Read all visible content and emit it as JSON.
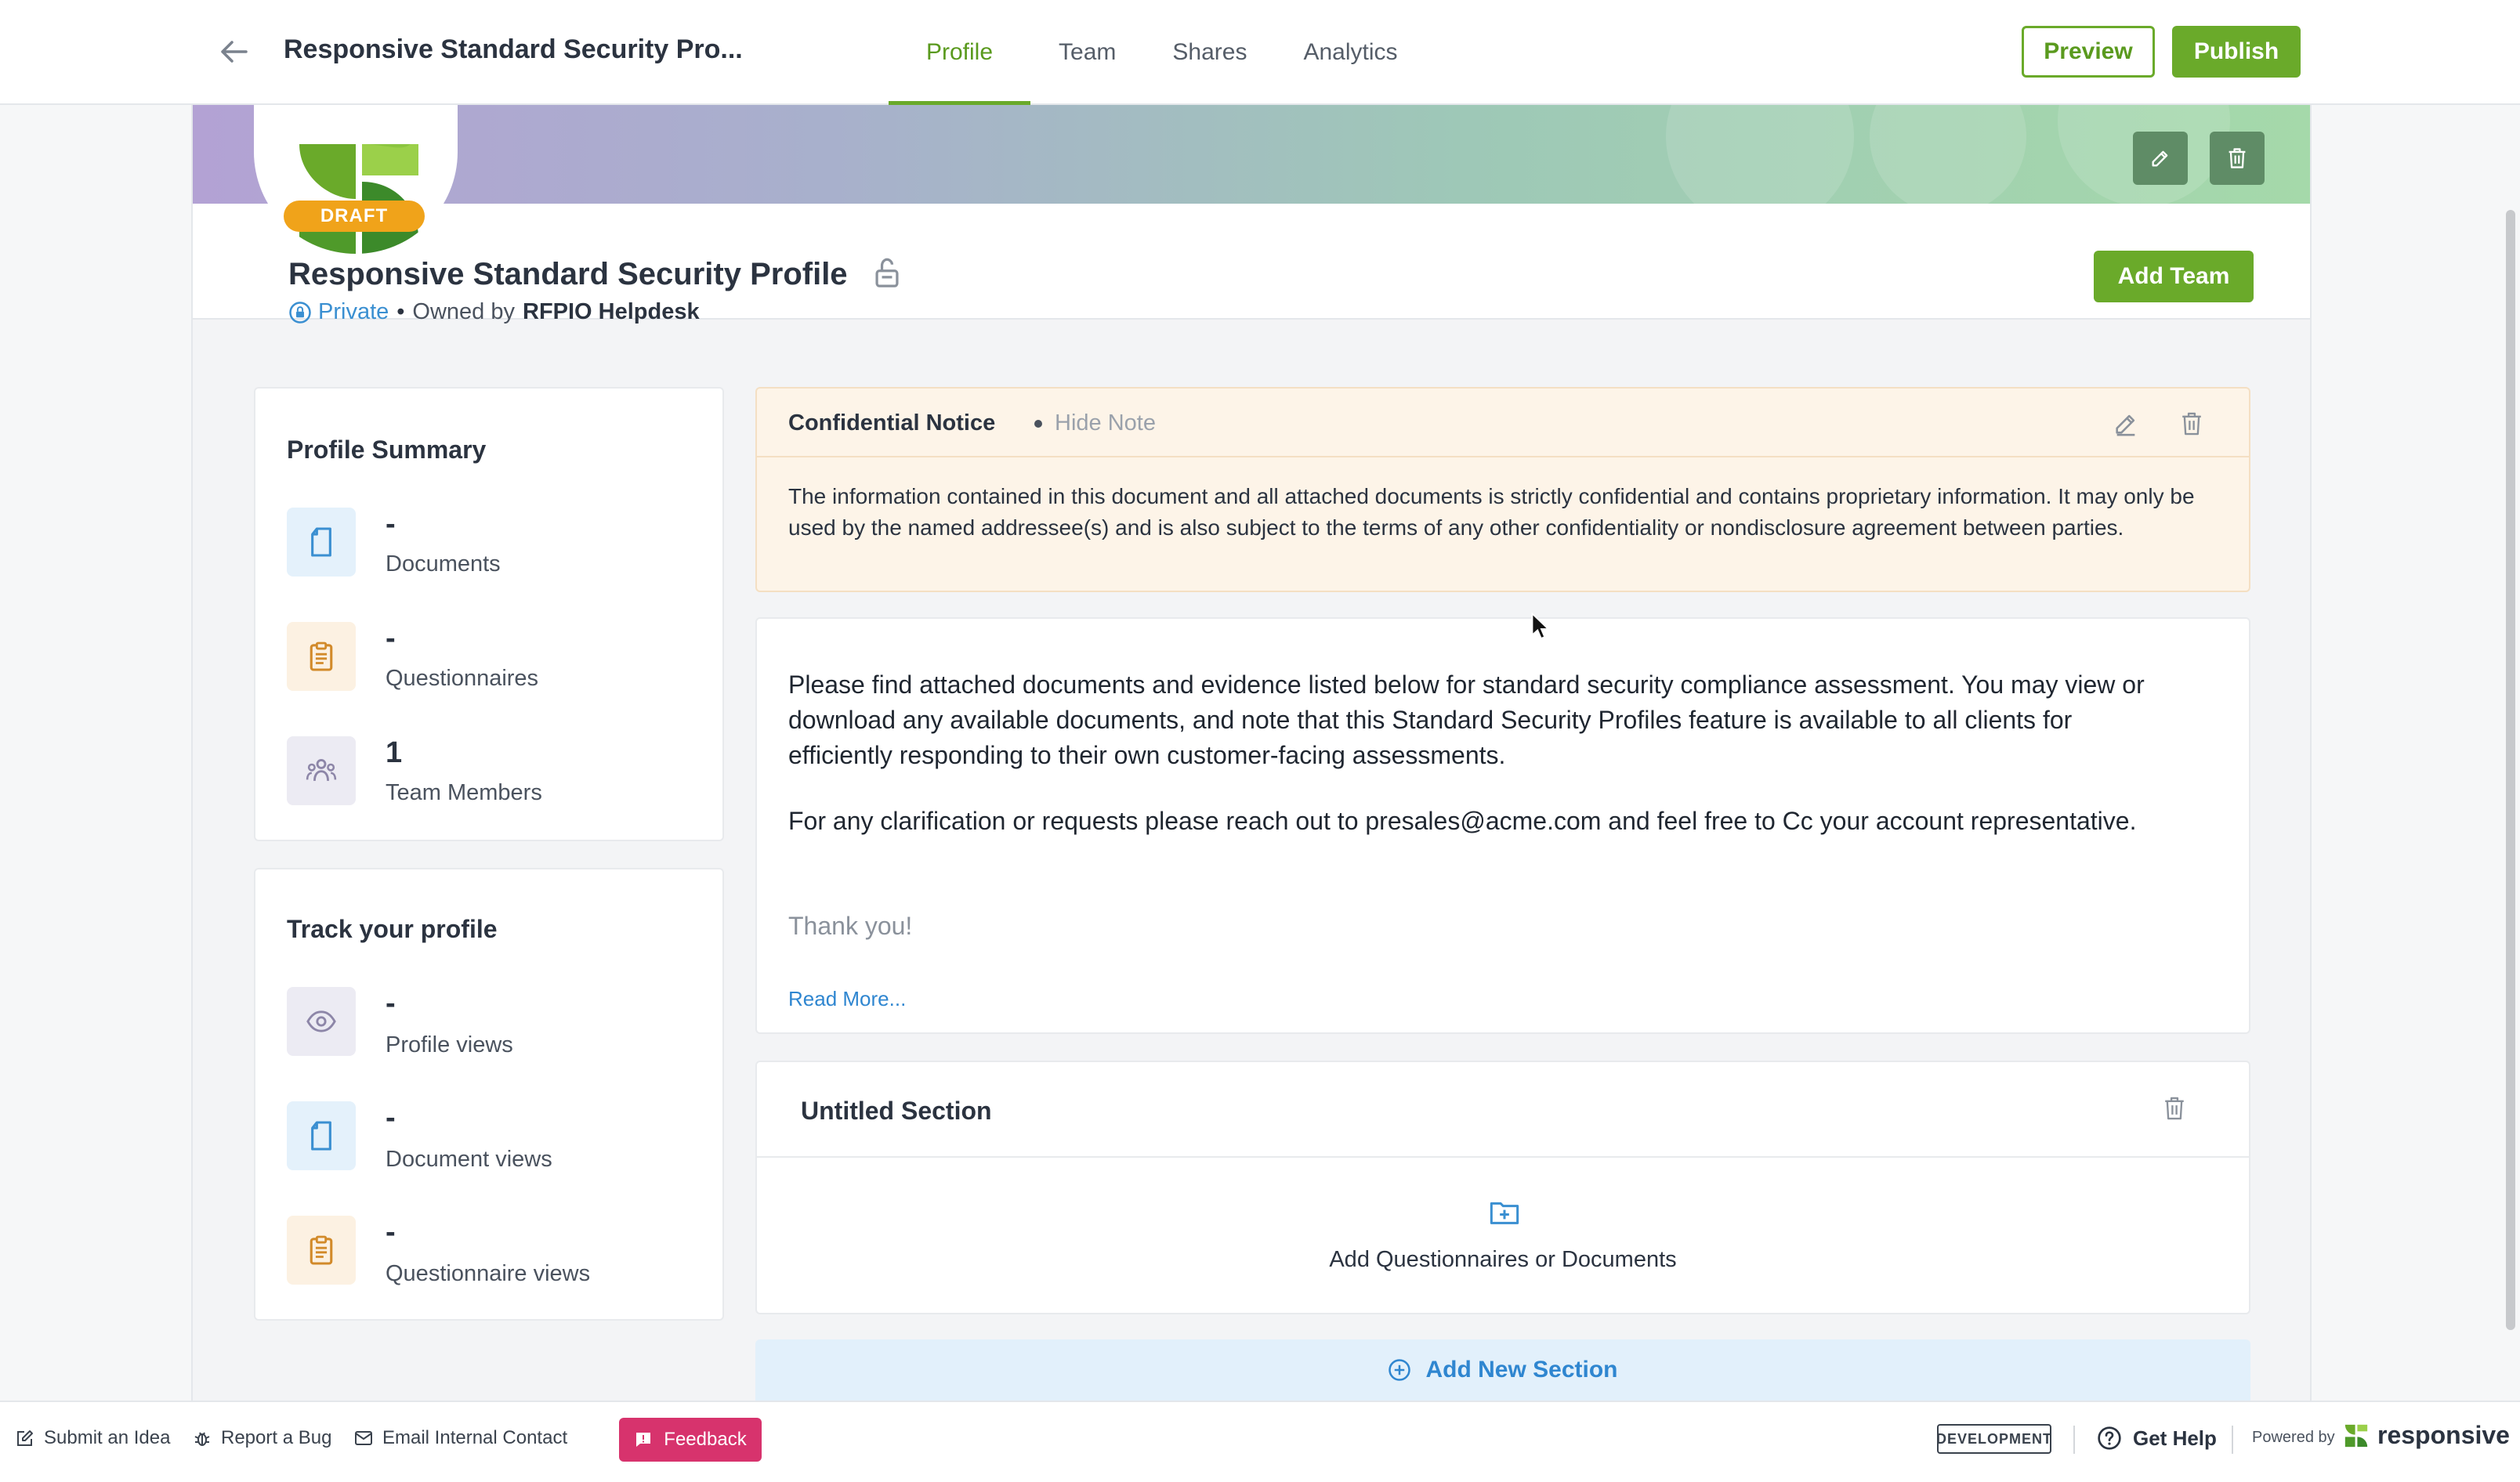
{
  "header": {
    "back_icon": "arrow-left-icon",
    "title": "Responsive Standard Security Pro...",
    "tabs": [
      {
        "label": "Profile",
        "active": true
      },
      {
        "label": "Team",
        "active": false
      },
      {
        "label": "Shares",
        "active": false
      },
      {
        "label": "Analytics",
        "active": false
      }
    ],
    "preview_label": "Preview",
    "publish_label": "Publish"
  },
  "profile": {
    "status_badge": "DRAFT",
    "title": "Responsive Standard Security Profile",
    "visibility": "Private",
    "owned_by_label": "Owned by",
    "owner": "RFPIO Helpdesk",
    "add_team_label": "Add Team"
  },
  "summary": {
    "title": "Profile Summary",
    "items": [
      {
        "value": "-",
        "label": "Documents",
        "icon": "document-icon"
      },
      {
        "value": "-",
        "label": "Questionnaires",
        "icon": "clipboard-icon"
      },
      {
        "value": "1",
        "label": "Team Members",
        "icon": "team-icon"
      }
    ]
  },
  "track": {
    "title": "Track your profile",
    "items": [
      {
        "value": "-",
        "label": "Profile views",
        "icon": "eye-icon"
      },
      {
        "value": "-",
        "label": "Document views",
        "icon": "document-icon"
      },
      {
        "value": "-",
        "label": "Questionnaire views",
        "icon": "clipboard-icon"
      }
    ]
  },
  "notice": {
    "title": "Confidential Notice",
    "hide_label": "Hide Note",
    "body": "The information contained in this document and all attached documents is strictly confidential and contains proprietary information. It may only be used by the named addressee(s) and is also subject to the terms of any other confidentiality or nondisclosure agreement between parties."
  },
  "description": {
    "p1": "Please find attached documents and evidence listed below for standard security compliance assessment. You may view or download any available documents, and note that this Standard Security Profiles feature is available to all clients for efficiently responding to their own customer-facing assessments.",
    "p2": "For any clarification or requests please reach out to presales@acme.com and feel free to Cc your account representative.",
    "p3": "Thank you!",
    "read_more": "Read More..."
  },
  "section": {
    "title": "Untitled Section",
    "add_label": "Add Questionnaires or Documents"
  },
  "add_section_label": "Add New Section",
  "footer": {
    "submit_idea": "Submit an Idea",
    "report_bug": "Report a Bug",
    "email_contact": "Email Internal Contact",
    "feedback": "Feedback",
    "env_badge": "DEVELOPMENT",
    "get_help": "Get Help",
    "powered_by": "Powered by",
    "brand": "responsive"
  },
  "colors": {
    "accent_green": "#6aaa2a",
    "draft_orange": "#f0a31a",
    "link_blue": "#2f86d0",
    "feedback_pink": "#d7336d"
  }
}
